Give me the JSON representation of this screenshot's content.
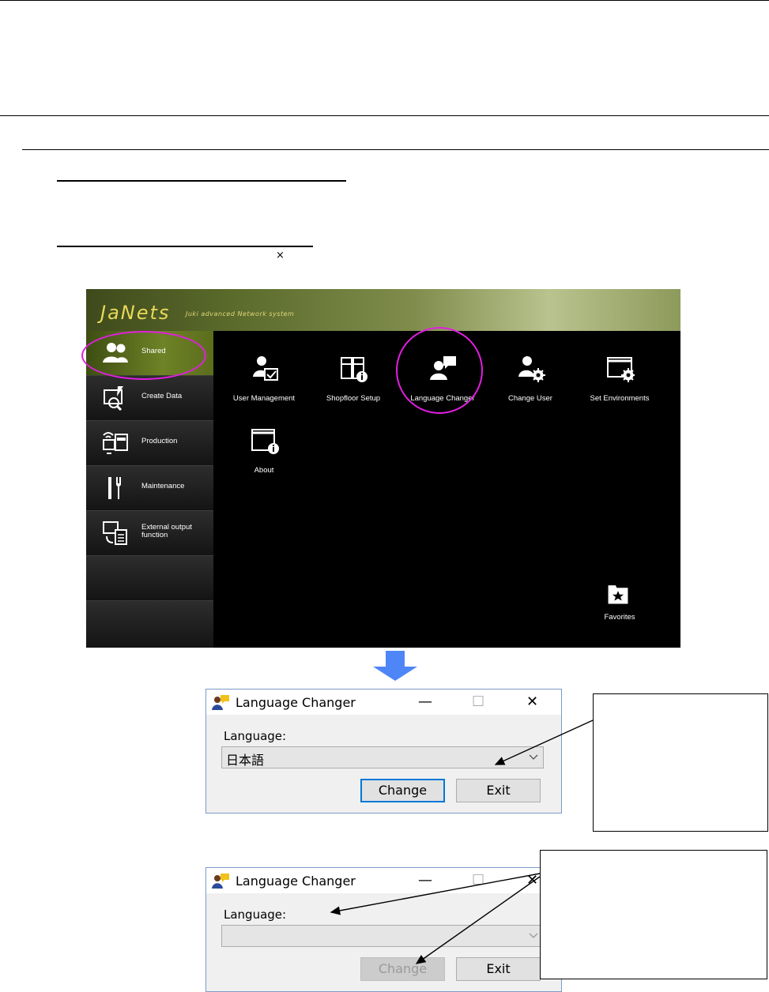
{
  "app": {
    "logo": "JaNets",
    "subtitle": "Juki advanced Network system",
    "sidebar": [
      "Shared",
      "Create Data",
      "Production",
      "Maintenance",
      "External output function",
      "",
      ""
    ],
    "tiles": [
      "User Management",
      "Shopfloor Setup",
      "Language Changer",
      "Change User",
      "Set Environments",
      "About"
    ],
    "favorites": "Favorites"
  },
  "close_glyph": "×",
  "dialog1": {
    "title": "Language Changer",
    "label": "Language:",
    "value": "日本語",
    "change": "Change",
    "exit": "Exit",
    "minimize": "—",
    "maximize": "☐",
    "close": "✕"
  },
  "dialog2": {
    "title": "Language Changer",
    "label": "Language:",
    "value": "",
    "change": "Change",
    "exit": "Exit",
    "minimize": "—",
    "maximize": "☐",
    "close": "✕"
  },
  "colors": {
    "highlight_circle": "#e21ee0",
    "arrow": "#4f86f7",
    "accent": "#0078d7"
  }
}
